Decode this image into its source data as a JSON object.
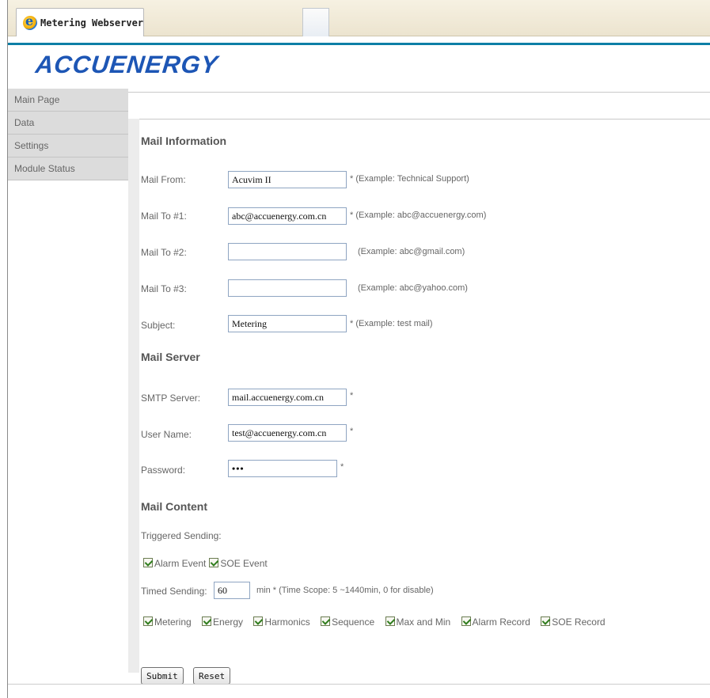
{
  "browser": {
    "tab_title": "Metering Webserver"
  },
  "brand": {
    "logo_text": "ACCUENERGY",
    "accent_color": "#0d7fa6",
    "logo_color": "#1d56b5"
  },
  "nav": {
    "items": [
      {
        "label": "Main Page"
      },
      {
        "label": "Data"
      },
      {
        "label": "Settings"
      },
      {
        "label": "Module Status"
      }
    ]
  },
  "mail_information": {
    "title": "Mail Information",
    "mail_from": {
      "label": "Mail From:",
      "value": "Acuvim II",
      "hint": "* (Example: Technical Support)"
    },
    "mail_to_1": {
      "label": "Mail To #1:",
      "value": "abc@accuenergy.com.cn",
      "hint": "* (Example: abc@accuenergy.com)"
    },
    "mail_to_2": {
      "label": "Mail To #2:",
      "value": "",
      "hint": "(Example: abc@gmail.com)"
    },
    "mail_to_3": {
      "label": "Mail To #3:",
      "value": "",
      "hint": "(Example: abc@yahoo.com)"
    },
    "subject": {
      "label": "Subject:",
      "value": "Metering",
      "hint": "* (Example: test mail)"
    }
  },
  "mail_server": {
    "title": "Mail Server",
    "smtp": {
      "label": "SMTP Server:",
      "value": "mail.accuenergy.com.cn",
      "hint": "*"
    },
    "user": {
      "label": "User Name:",
      "value": "test@accuenergy.com.cn",
      "hint": "*"
    },
    "password": {
      "label": "Password:",
      "value": "•••",
      "hint": "*"
    }
  },
  "mail_content": {
    "title": "Mail Content",
    "triggered_label": "Triggered Sending:",
    "triggered_options": [
      {
        "label": "Alarm Event",
        "checked": true
      },
      {
        "label": "SOE Event",
        "checked": true
      }
    ],
    "timed_label": "Timed Sending:",
    "timed_value": "60",
    "timed_hint": "min * (Time Scope: 5 ~1440min, 0 for disable)",
    "content_options": [
      {
        "label": "Metering",
        "checked": true
      },
      {
        "label": "Energy",
        "checked": true
      },
      {
        "label": "Harmonics",
        "checked": true
      },
      {
        "label": "Sequence",
        "checked": true
      },
      {
        "label": "Max and Min",
        "checked": true
      },
      {
        "label": "Alarm Record",
        "checked": true
      },
      {
        "label": "SOE Record",
        "checked": true
      }
    ]
  },
  "actions": {
    "submit_label": "Submit",
    "reset_label": "Reset"
  }
}
